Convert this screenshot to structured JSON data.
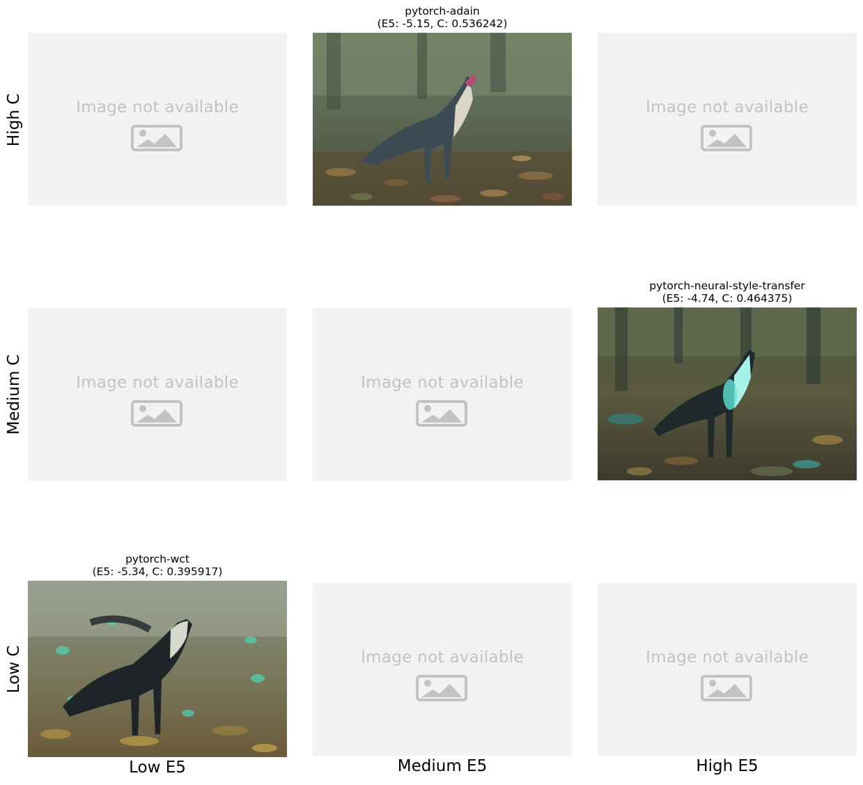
{
  "rows": [
    "High C",
    "Medium C",
    "Low C"
  ],
  "columns": [
    "Low E5",
    "Medium E5",
    "High E5"
  ],
  "placeholder_text": "Image not available",
  "placeholder_icon": "image-icon",
  "images": [
    {
      "row": "High C",
      "column": "Medium E5",
      "name": "pytorch-adain",
      "metrics": "(E5: -5.15, C: 0.536242)"
    },
    {
      "row": "Medium C",
      "column": "High E5",
      "name": "pytorch-neural-style-transfer",
      "metrics": "(E5: -4.74, C: 0.464375)"
    },
    {
      "row": "Low C",
      "column": "Low E5",
      "name": "pytorch-wct",
      "metrics": "(E5: -5.34, C: 0.395917)"
    }
  ]
}
